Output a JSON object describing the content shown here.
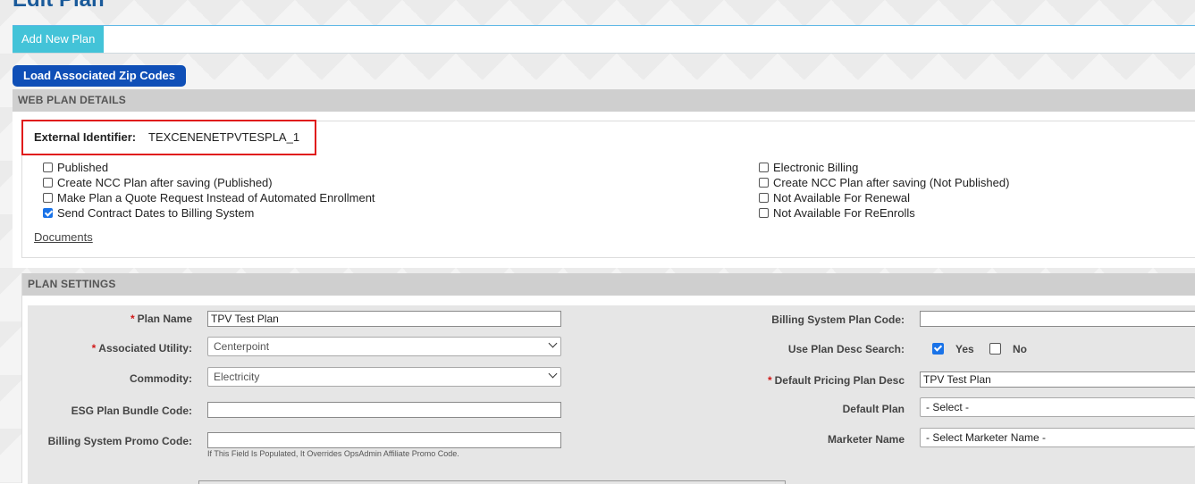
{
  "page": {
    "title": "Edit Plan"
  },
  "tabs": {
    "add_new_plan": "Add New Plan"
  },
  "buttons": {
    "load_zip_codes": "Load Associated Zip Codes"
  },
  "web_plan": {
    "header": "WEB PLAN DETAILS",
    "external_identifier_label": "External Identifier:",
    "external_identifier_value": "TEXCENENETPVTESPLA_1",
    "left_checkboxes": [
      {
        "label": "Published",
        "checked": false
      },
      {
        "label": "Create NCC Plan after saving (Published)",
        "checked": false
      },
      {
        "label": "Make Plan a Quote Request Instead of Automated Enrollment",
        "checked": false
      },
      {
        "label": "Send Contract Dates to Billing System",
        "checked": true
      }
    ],
    "right_checkboxes": [
      {
        "label": "Electronic Billing",
        "checked": false
      },
      {
        "label": "Create NCC Plan after saving (Not Published)",
        "checked": false
      },
      {
        "label": "Not Available For Renewal",
        "checked": false
      },
      {
        "label": "Not Available For ReEnrolls",
        "checked": false
      }
    ],
    "documents_link": "Documents"
  },
  "plan_settings": {
    "header": "PLAN SETTINGS",
    "required_mark": "*",
    "plan_name": {
      "label": "Plan Name",
      "value": "TPV Test Plan"
    },
    "associated_utility": {
      "label": "Associated Utility:",
      "value": "Centerpoint"
    },
    "commodity": {
      "label": "Commodity:",
      "value": "Electricity"
    },
    "esg_plan_bundle_code": {
      "label": "ESG Plan Bundle Code:",
      "value": ""
    },
    "billing_system_promo_code": {
      "label": "Billing System Promo Code:",
      "value": "",
      "hint": "If This Field Is Populated, It Overrides OpsAdmin Affiliate Promo Code."
    },
    "billing_system_plan_code": {
      "label": "Billing System Plan Code:",
      "value": ""
    },
    "use_plan_desc_search": {
      "label": "Use Plan Desc Search:",
      "yes": "Yes",
      "no": "No",
      "yes_checked": true,
      "no_checked": false
    },
    "default_pricing_plan_desc": {
      "label": "Default Pricing Plan Desc",
      "value": "TPV Test Plan"
    },
    "default_plan": {
      "label": "Default Plan",
      "value": "- Select -"
    },
    "marketer_name": {
      "label": "Marketer Name",
      "value": "- Select Marketer Name -"
    }
  }
}
